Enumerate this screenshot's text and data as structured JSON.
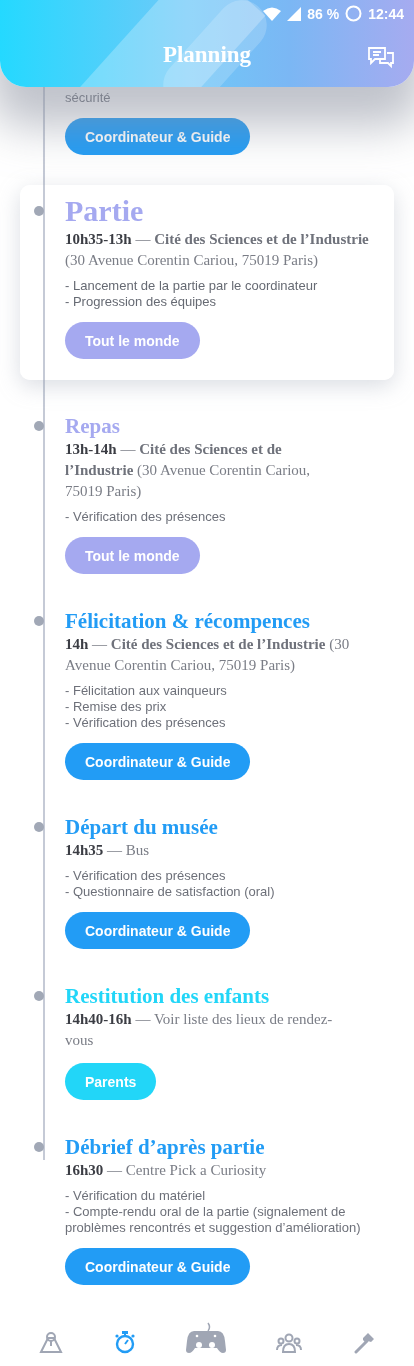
{
  "status_bar": {
    "battery": "86 %",
    "time": "12:44"
  },
  "header": {
    "title": "Planning"
  },
  "events": [
    {
      "selected": false,
      "color": "#229cf5",
      "tasks": [
        "sécurité"
      ],
      "audience": "Coordinateur & Guide"
    },
    {
      "selected": true,
      "color": "#a5a9f0",
      "title": "Partie",
      "details": "**10h35-13h** — **Cité des Sciences et de l’Industrie** (30 Avenue Corentin Cariou, 75019 Paris)",
      "tasks": [
        "- Lancement de la partie par le coordinateur",
        "- Progression des équipes"
      ],
      "audience": "Tout le monde"
    },
    {
      "selected": false,
      "color": "#a5a9f0",
      "title": "Repas",
      "details": "**13h-14h** — **Cité des Sciences et de l’Industrie** (30 Avenue Corentin Cariou, 75019 Paris)",
      "tasks": [
        "- Vérification des présences"
      ],
      "audience": "Tout le monde"
    },
    {
      "selected": false,
      "color": "#229cf5",
      "title": "Félicitation & récompences",
      "details": "**14h** — **Cité des Sciences et de l’Industrie** (30 Avenue Corentin Cariou, 75019 Paris)",
      "tasks": [
        "- Félicitation aux vainqueurs",
        "- Remise des prix",
        "- Vérification des présences"
      ],
      "audience": "Coordinateur & Guide"
    },
    {
      "selected": false,
      "color": "#229cf5",
      "title": "Départ du musée",
      "details": "**14h35** — Bus",
      "tasks": [
        "- Vérification des présences",
        "- Questionnaire de satisfaction (oral)"
      ],
      "audience": "Coordinateur & Guide"
    },
    {
      "selected": false,
      "color": "#22d6f8",
      "title": "Restitution des enfants",
      "details": "**14h40-16h** — Voir liste des lieux de rendez-vous",
      "audience": "Parents"
    },
    {
      "selected": false,
      "color": "#229cf5",
      "title": "Débrief d’après partie",
      "details": "**16h30** — Centre Pick a Curiosity",
      "tasks": [
        "- Vérification du matériel",
        "- Compte-rendu oral de la partie (signalement de problèmes rencontrés et suggestion d’amélioration)"
      ],
      "audience": "Coordinateur & Guide"
    }
  ],
  "nav": [
    {
      "selected": false
    },
    {
      "selected": true
    },
    {
      "selected": false
    },
    {
      "selected": false
    },
    {
      "selected": false
    }
  ]
}
